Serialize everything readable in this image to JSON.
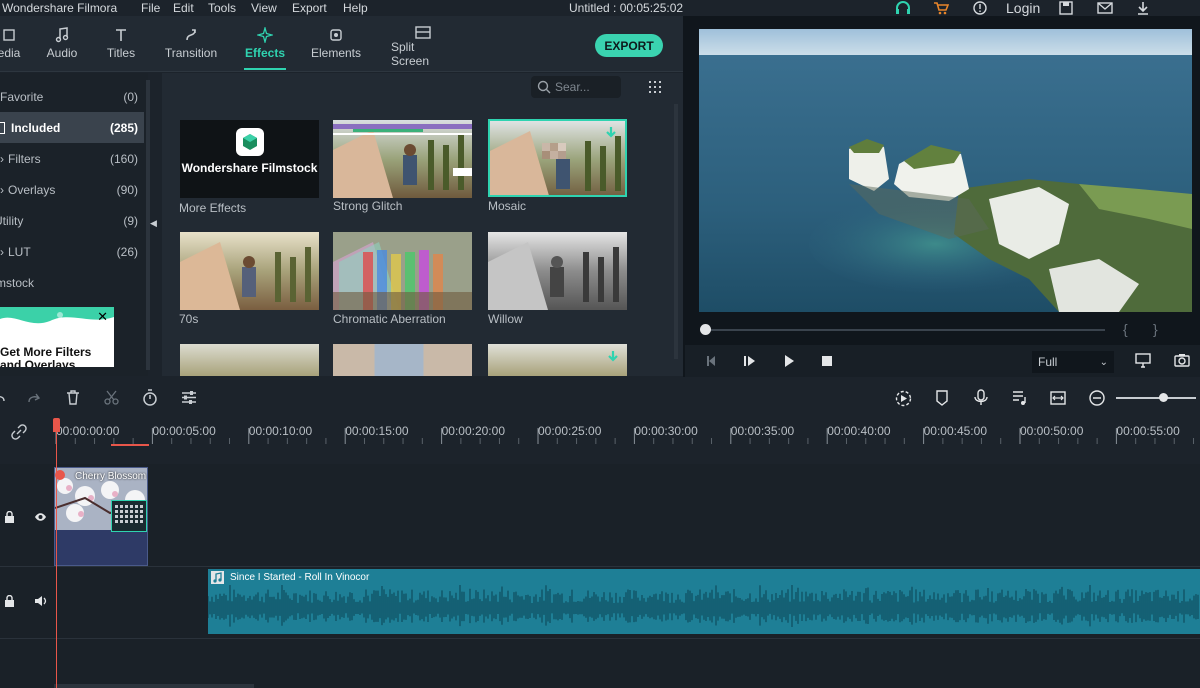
{
  "app": {
    "title": "Wondershare Filmora",
    "document_title": "Untitled : 00:05:25:02"
  },
  "menu": {
    "items": [
      "File",
      "Edit",
      "Tools",
      "View",
      "Export",
      "Help"
    ],
    "login_label": "Login"
  },
  "library_tabs": [
    {
      "label": "edia",
      "icon": "media-icon"
    },
    {
      "label": "Audio",
      "icon": "music-note-icon"
    },
    {
      "label": "Titles",
      "icon": "text-icon"
    },
    {
      "label": "Transition",
      "icon": "transition-icon"
    },
    {
      "label": "Effects",
      "icon": "effects-sparkle-icon",
      "active": true
    },
    {
      "label": "Elements",
      "icon": "elements-icon"
    },
    {
      "label": "Split Screen",
      "icon": "split-screen-icon"
    }
  ],
  "export_label": "EXPORT",
  "categories": [
    {
      "label": "Favorite",
      "count": "(0)"
    },
    {
      "label": "Included",
      "count": "(285)",
      "selected": true
    },
    {
      "label": "Filters",
      "count": "(160)"
    },
    {
      "label": "Overlays",
      "count": "(90)"
    },
    {
      "label": "Utility",
      "count": "(9)"
    },
    {
      "label": "LUT",
      "count": "(26)"
    },
    {
      "label": "mstock",
      "count": ""
    }
  ],
  "promo": {
    "label": "Get More Filters and Overlays"
  },
  "search": {
    "placeholder": "Sear..."
  },
  "effects": [
    {
      "label": "More Effects",
      "logo_text": "Wondershare Filmstock"
    },
    {
      "label": "Strong Glitch"
    },
    {
      "label": "Mosaic",
      "selected": true
    },
    {
      "label": "70s"
    },
    {
      "label": "Chromatic Aberration"
    },
    {
      "label": "Willow"
    }
  ],
  "player": {
    "quality": "Full",
    "progress": 0
  },
  "timeline": {
    "ticks": [
      "00:00:00:00",
      "00:00:05:00",
      "00:00:10:00",
      "00:00:15:00",
      "00:00:20:00",
      "00:00:25:00",
      "00:00:30:00",
      "00:00:35:00",
      "00:00:40:00",
      "00:00:45:00",
      "00:00:50:00",
      "00:00:55:00"
    ],
    "video_clip": {
      "title": "Cherry Blossom"
    },
    "audio_clip": {
      "title": "Since I Started - Roll In Vinocor"
    }
  },
  "colors": {
    "accent": "#2fd3b0",
    "playhead": "#e8564a",
    "audio_clip": "#1e7f96"
  }
}
